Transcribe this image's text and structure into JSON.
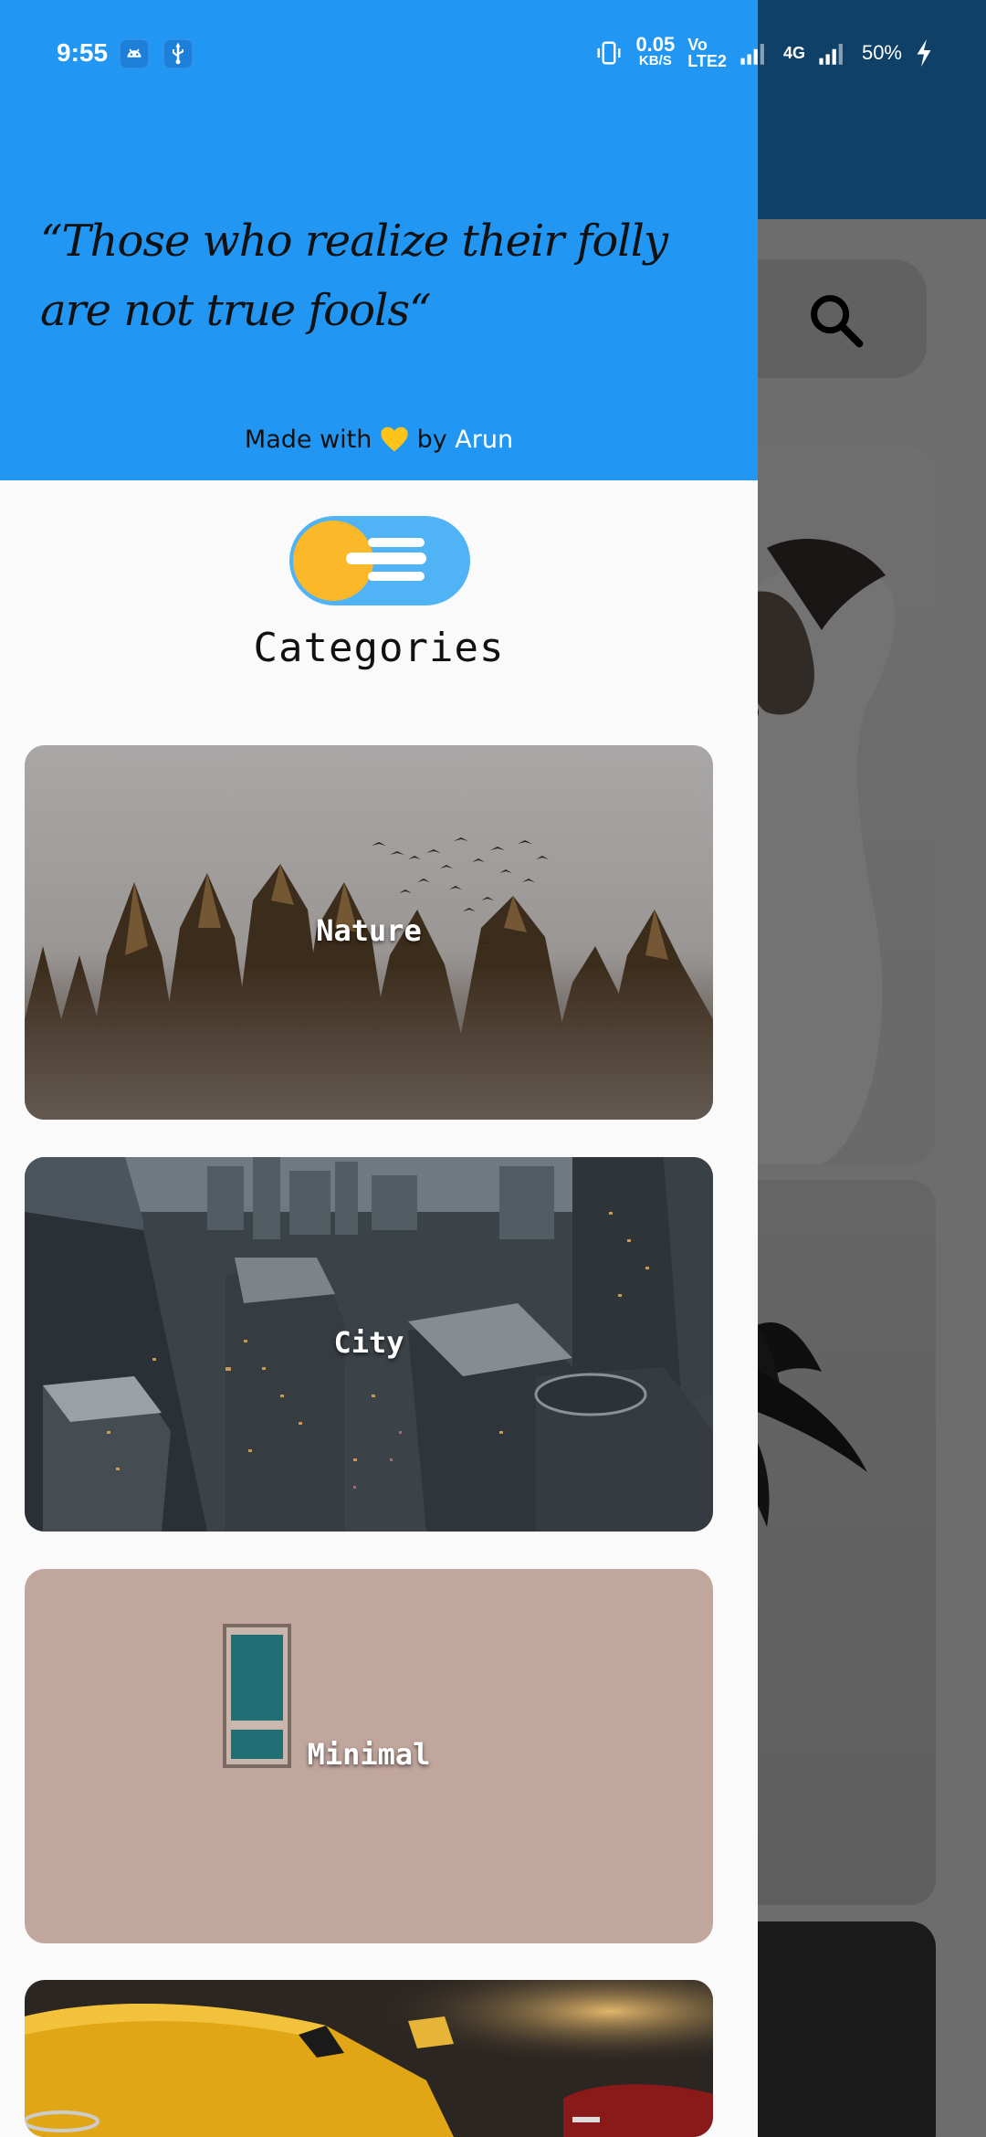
{
  "status_bar": {
    "time": "9:55",
    "net_speed_value": "0.05",
    "net_speed_unit": "KB/S",
    "volte_top": "Vo",
    "volte_bottom": "LTE2",
    "network_type": "4G",
    "battery": "50%"
  },
  "drawer": {
    "quote": "“Those who realize their folly are not true fools“",
    "made_with_prefix": "Made with",
    "made_with_by": "by",
    "author": "Arun",
    "section_title": "Categories",
    "categories": [
      {
        "label": "Nature"
      },
      {
        "label": "City"
      },
      {
        "label": "Minimal"
      },
      {
        "label": ""
      }
    ]
  },
  "colors": {
    "accent": "#2196f3",
    "heart": "#fcc419",
    "toggle_knob": "#fbb829",
    "toggle_track": "#4fb3f6"
  },
  "icons": [
    "android-icon",
    "usb-icon",
    "vibrate-icon",
    "signal-icon",
    "charging-icon",
    "search-icon",
    "heart-icon",
    "menu-toggle-icon"
  ]
}
